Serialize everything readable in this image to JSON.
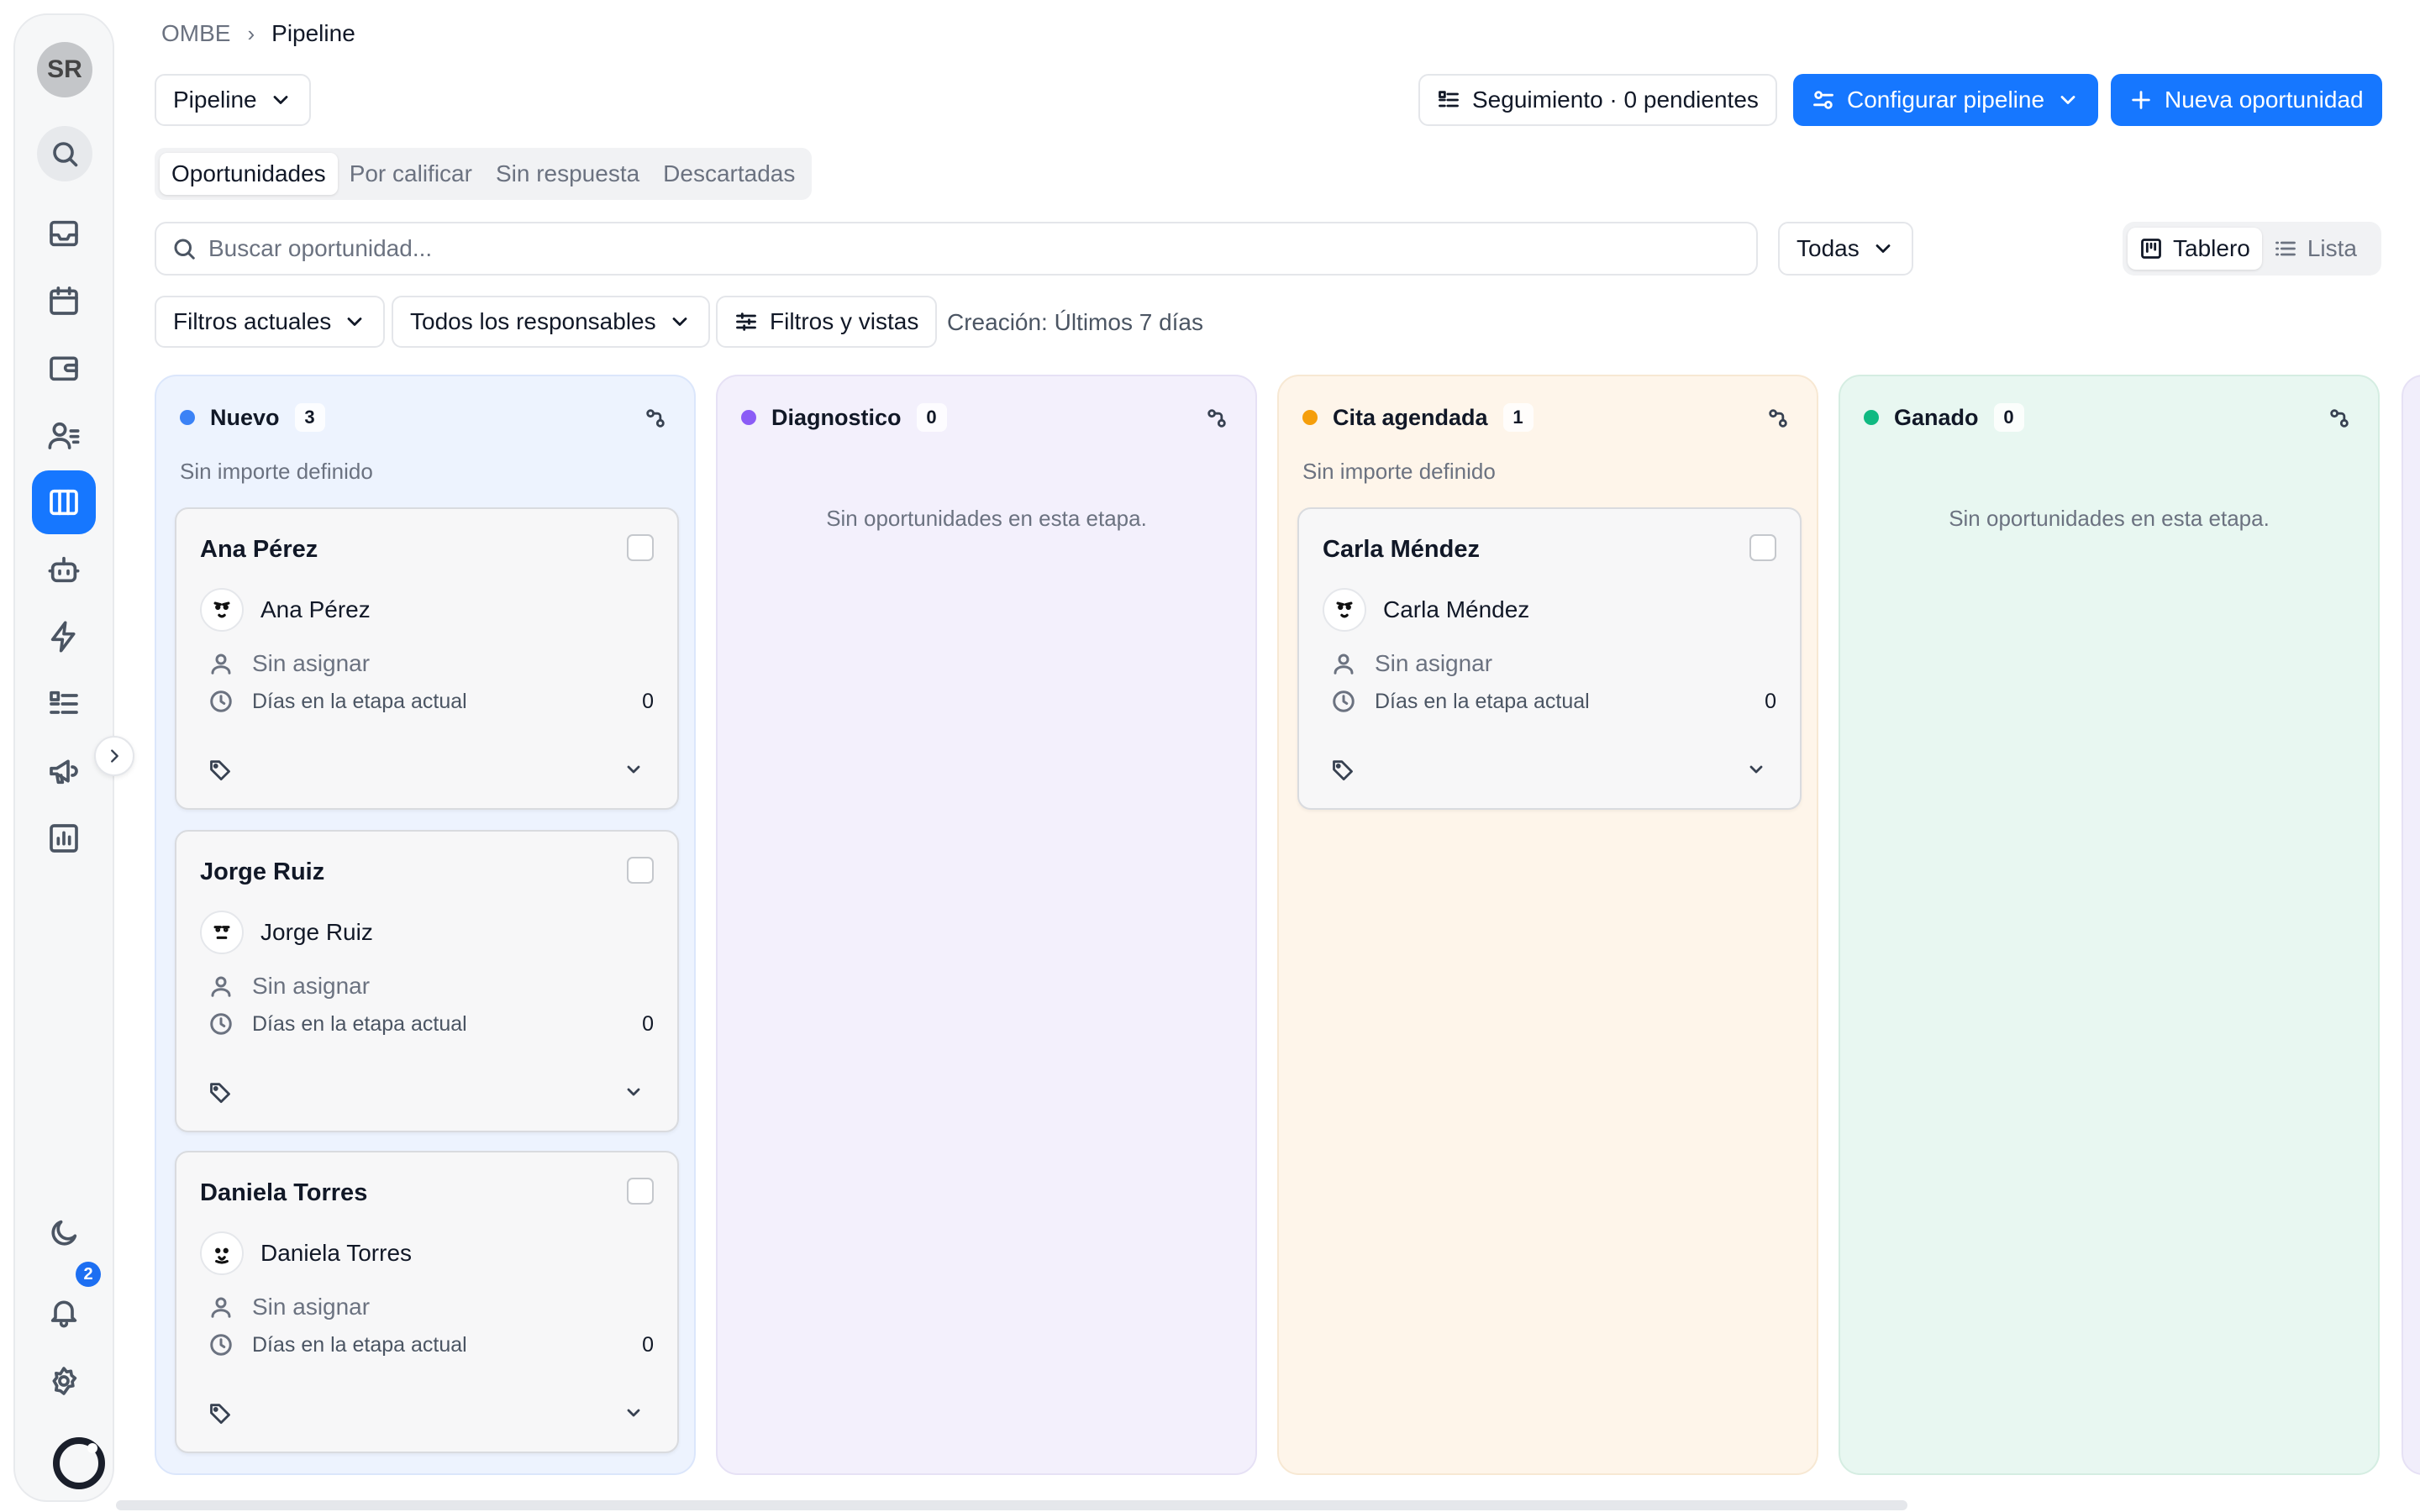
{
  "sidebar": {
    "avatar_initials": "SR",
    "notification_count": "2",
    "items": [
      {
        "name": "inbox"
      },
      {
        "name": "calendar"
      },
      {
        "name": "wallet"
      },
      {
        "name": "contacts"
      },
      {
        "name": "pipeline",
        "active": true
      },
      {
        "name": "bot"
      },
      {
        "name": "automations"
      },
      {
        "name": "tasks"
      },
      {
        "name": "campaigns"
      },
      {
        "name": "reports"
      }
    ]
  },
  "breadcrumb": {
    "root": "OMBE",
    "separator": "›",
    "current": "Pipeline"
  },
  "header": {
    "pipeline_select": "Pipeline",
    "follow_up": "Seguimiento · 0 pendientes",
    "configure": "Configurar pipeline",
    "new_opportunity": "Nueva oportunidad"
  },
  "tabs": [
    "Oportunidades",
    "Por calificar",
    "Sin respuesta",
    "Descartadas"
  ],
  "search": {
    "placeholder": "Buscar oportunidad...",
    "value": ""
  },
  "scope_select": "Todas",
  "view_toggle": {
    "board": "Tablero",
    "list": "Lista",
    "active": "board"
  },
  "filters": {
    "current": "Filtros actuales",
    "owners": "Todos los responsables",
    "views": "Filtros y vistas",
    "creation": "Creación: Últimos 7 días"
  },
  "columns": [
    {
      "title": "Nuevo",
      "count": "3",
      "subtitle": "Sin importe definido",
      "color": "#3b82f6",
      "bg": "#edf3fe",
      "border": "#dbe6fb",
      "empty_text": "",
      "cards": [
        {
          "title": "Ana Pérez",
          "contact": "Ana Pérez",
          "assignee": "Sin asignar",
          "days_label": "Días en la etapa actual",
          "days": "0"
        },
        {
          "title": "Jorge Ruiz",
          "contact": "Jorge Ruiz",
          "assignee": "Sin asignar",
          "days_label": "Días en la etapa actual",
          "days": "0"
        },
        {
          "title": "Daniela Torres",
          "contact": "Daniela Torres",
          "assignee": "Sin asignar",
          "days_label": "Días en la etapa actual",
          "days": "0"
        }
      ]
    },
    {
      "title": "Diagnostico",
      "count": "0",
      "subtitle": "",
      "color": "#8b5cf6",
      "bg": "#f3f0fc",
      "border": "#e6e1f5",
      "empty_text": "Sin oportunidades en esta etapa.",
      "cards": []
    },
    {
      "title": "Cita agendada",
      "count": "1",
      "subtitle": "Sin importe definido",
      "color": "#f59e0b",
      "bg": "#fef5ea",
      "border": "#f7e8d3",
      "empty_text": "",
      "cards": [
        {
          "title": "Carla Méndez",
          "contact": "Carla Méndez",
          "assignee": "Sin asignar",
          "days_label": "Días en la etapa actual",
          "days": "0"
        }
      ]
    },
    {
      "title": "Ganado",
      "count": "0",
      "subtitle": "",
      "color": "#10b981",
      "bg": "#e8f7f1",
      "border": "#d5ede2",
      "empty_text": "Sin oportunidades en esta etapa.",
      "cards": []
    }
  ]
}
